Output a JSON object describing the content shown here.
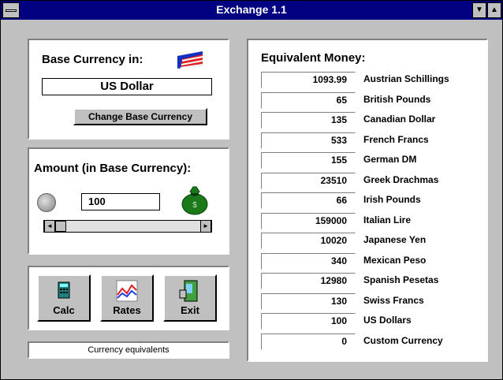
{
  "window": {
    "title": "Exchange 1.1"
  },
  "titlebar": {
    "min_glyph": "▼",
    "max_glyph": "▲"
  },
  "base_panel": {
    "label": "Base Currency in:",
    "current": "US Dollar",
    "change_button": "Change Base Currency",
    "flag_icon": "us-flag-icon"
  },
  "amount_panel": {
    "label": "Amount (in Base Currency):",
    "value": "100",
    "coin_icon": "coin-icon",
    "bag_icon": "money-bag-icon",
    "scroll_left": "◄",
    "scroll_right": "►"
  },
  "buttons": [
    {
      "label": "Calc",
      "icon": "calculator-icon"
    },
    {
      "label": "Rates",
      "icon": "chart-icon"
    },
    {
      "label": "Exit",
      "icon": "exit-door-icon"
    }
  ],
  "status": "Currency equivalents",
  "equivalent": {
    "label": "Equivalent Money:",
    "rows": [
      {
        "value": "1093.99",
        "name": "Austrian Schillings"
      },
      {
        "value": "65",
        "name": "British Pounds"
      },
      {
        "value": "135",
        "name": "Canadian Dollar"
      },
      {
        "value": "533",
        "name": "French Francs"
      },
      {
        "value": "155",
        "name": "German DM"
      },
      {
        "value": "23510",
        "name": "Greek Drachmas"
      },
      {
        "value": "66",
        "name": "Irish Pounds"
      },
      {
        "value": "159000",
        "name": "Italian Lire"
      },
      {
        "value": "10020",
        "name": "Japanese Yen"
      },
      {
        "value": "340",
        "name": "Mexican Peso"
      },
      {
        "value": "12980",
        "name": "Spanish Pesetas"
      },
      {
        "value": "130",
        "name": "Swiss Francs"
      },
      {
        "value": "100",
        "name": "US Dollars"
      },
      {
        "value": "0",
        "name": "Custom Currency"
      }
    ]
  },
  "colors": {
    "titlebar": "#000080",
    "face": "#c0c0c0",
    "bag": "#1a7a1a"
  }
}
